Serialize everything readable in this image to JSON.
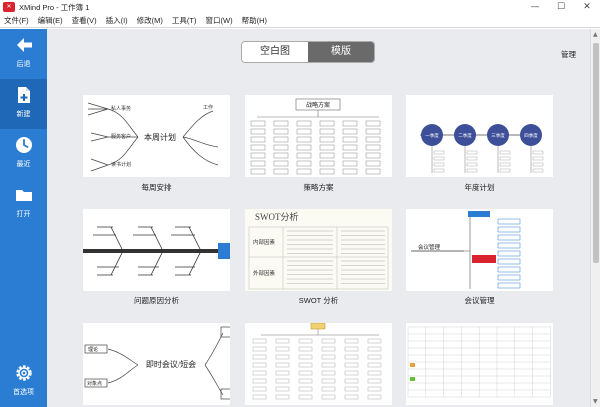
{
  "window": {
    "title": "XMind Pro - 工作簿 1",
    "minimize": "—",
    "maximize": "☐",
    "close": "✕"
  },
  "menu": [
    "文件(F)",
    "编辑(E)",
    "查看(V)",
    "插入(I)",
    "修改(M)",
    "工具(T)",
    "窗口(W)",
    "帮助(H)"
  ],
  "sidebar": [
    {
      "label": "后退",
      "icon": "back-arrow-icon"
    },
    {
      "label": "新建",
      "icon": "new-file-icon",
      "active": true
    },
    {
      "label": "最近",
      "icon": "clock-icon"
    },
    {
      "label": "打开",
      "icon": "folder-icon"
    },
    {
      "label": "首选项",
      "icon": "gear-icon"
    }
  ],
  "tabs": {
    "blank": "空白图",
    "template": "模版"
  },
  "manage": "管理",
  "templates": [
    {
      "label": "每周安排"
    },
    {
      "label": "策略方案"
    },
    {
      "label": "年度计划"
    },
    {
      "label": "问题原因分析"
    },
    {
      "label": "SWOT 分析"
    },
    {
      "label": "会议管理"
    },
    {
      "label": ""
    },
    {
      "label": ""
    },
    {
      "label": ""
    }
  ],
  "thumbs": {
    "weekly": {
      "center": "本周计划",
      "left": [
        "私人事务",
        "服务客户",
        "读书计划"
      ],
      "right": [
        "工作"
      ]
    },
    "strategy": {
      "root": "战略方案"
    },
    "annual": {
      "nodes": [
        "一季度",
        "二季度",
        "三季度",
        "四季度"
      ]
    },
    "swot": {
      "title": "SWOT分析",
      "rows": [
        "内部因素",
        "外部因素"
      ]
    },
    "meeting": {
      "center": "会议管理"
    },
    "instant": {
      "center": "即时会议/短会",
      "left": [
        "理论",
        "对象点"
      ]
    }
  }
}
